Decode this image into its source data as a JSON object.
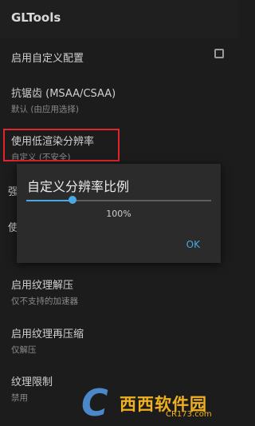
{
  "app": {
    "title": "GLTools"
  },
  "settings": [
    {
      "label": "启用自定义配置"
    },
    {
      "label": "抗锯齿 (MSAA/CSAA)",
      "summary": "默认 (由应用选择)"
    },
    {
      "label": "使用低渲染分辨率",
      "summary": "自定义 (不安全)"
    },
    {
      "label": "启用纹理解压",
      "summary": "仅不支持的加速器"
    },
    {
      "label": "启用纹理再压缩",
      "summary": "仅解压"
    },
    {
      "label": "纹理限制",
      "summary": "禁用"
    }
  ],
  "peek": {
    "row1": "强",
    "row2": "使"
  },
  "dialog": {
    "title": "自定义分辨率比例",
    "slider_value": 0.25,
    "percent_text": "100%",
    "ok_label": "OK"
  },
  "watermark": {
    "text": "西西软件园",
    "sub": "CR173.com"
  },
  "colors": {
    "accent": "#4aa8e4",
    "highlight": "#e0262c"
  }
}
